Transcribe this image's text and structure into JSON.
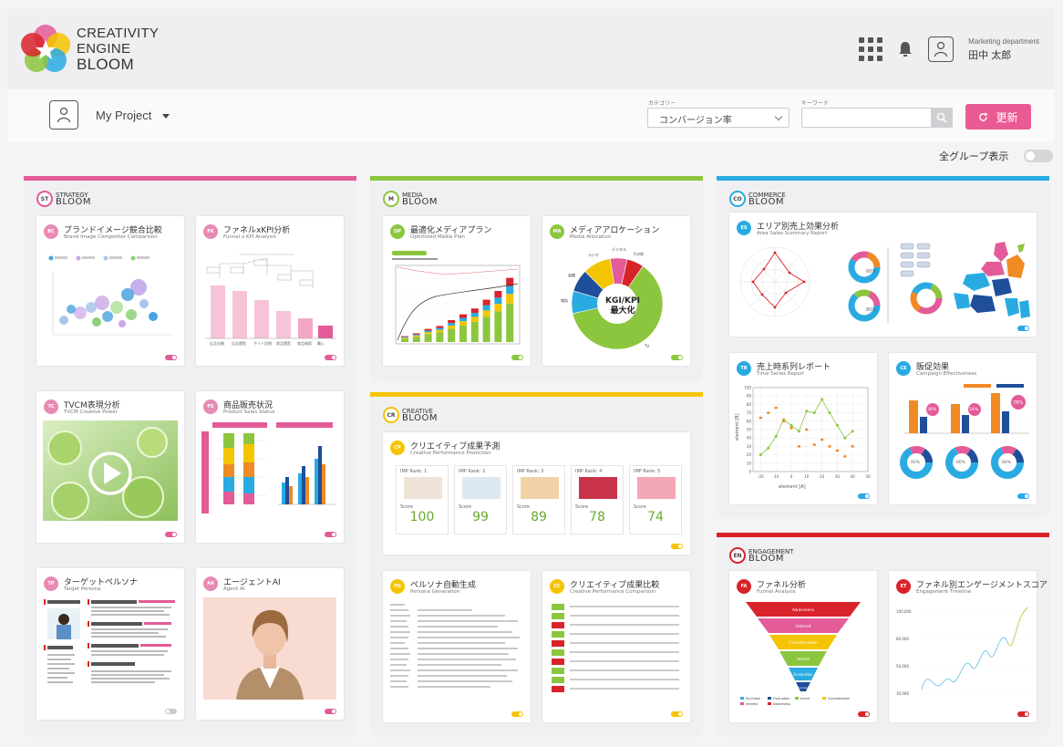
{
  "header": {
    "logo_line1": "CREATIVITY",
    "logo_line2": "ENGINE",
    "logo_line3": "BLOOM",
    "user_department": "Marketing department",
    "user_name": "田中 太郎",
    "icons": [
      "apps-grid-icon",
      "bell-icon",
      "user-icon"
    ]
  },
  "toolbar": {
    "project_label": "My Project",
    "category_label": "カテゴリー",
    "category_value": "コンバージョン率",
    "keyword_label": "キーワード",
    "keyword_value": "",
    "refresh_label": "更新"
  },
  "show_all_label": "全グループ表示",
  "colors": {
    "strategy": "#e35b98",
    "media": "#8cc63f",
    "commerce": "#29abe2",
    "creative": "#f5c400",
    "engagement": "#d9232a",
    "refresh": "#ea5b93"
  },
  "groups": {
    "strategy": {
      "line1": "STRATEGY",
      "line2": "BLOOM",
      "badge": "ST"
    },
    "media": {
      "line1": "MEDIA",
      "line2": "BLOOM",
      "badge": "M"
    },
    "commerce": {
      "line1": "COMMERCE",
      "line2": "BLOOM",
      "badge": "CO"
    },
    "creative": {
      "line1": "CREATIVE",
      "line2": "BLOOM",
      "badge": "CR"
    },
    "engagement": {
      "line1": "ENGAGEMENT",
      "line2": "BLOOM",
      "badge": "EN"
    }
  },
  "cards": {
    "bc": {
      "badge": "BC",
      "title": "ブランドイメージ競合比較",
      "subtitle": "Brand Image Competitor Comparison"
    },
    "fk": {
      "badge": "FK",
      "title": "ファネルxKPI分析",
      "subtitle": "Funnel x KPI Analysis"
    },
    "tc": {
      "badge": "TC",
      "title": "TVCM表現分析",
      "subtitle": "TVCM Creative Power"
    },
    "ps": {
      "badge": "PS",
      "title": "商品販売状況",
      "subtitle": "Product Sales Status"
    },
    "tp": {
      "badge": "TP",
      "title": "ターゲットペルソナ",
      "subtitle": "Target Persona"
    },
    "ai": {
      "badge": "AA",
      "title": "エージェントAI",
      "subtitle": "Agent AI"
    },
    "op": {
      "badge": "OP",
      "title": "最適化メディアプラン",
      "subtitle": "Optimized Media Plan"
    },
    "ma": {
      "badge": "MA",
      "title": "メディアアロケーション",
      "subtitle": "Media Allocation",
      "center_line1": "KGI/KPI",
      "center_line2": "最大化"
    },
    "cp": {
      "badge": "CP",
      "title": "クリエイティブ成果予測",
      "subtitle": "Creative Performance Prediction",
      "scores": [
        {
          "label": "IMP Rank: 1",
          "value": "100"
        },
        {
          "label": "IMP Rank: 2",
          "value": "99"
        },
        {
          "label": "IMP Rank: 3",
          "value": "89"
        },
        {
          "label": "IMP Rank: 4",
          "value": "78"
        },
        {
          "label": "IMP Rank: 5",
          "value": "74"
        }
      ],
      "score_caption": "Score"
    },
    "pg": {
      "badge": "PG",
      "title": "ペルソナ自動生成",
      "subtitle": "Persona Generation"
    },
    "cc": {
      "badge": "CC",
      "title": "クリエイティブ成果比較",
      "subtitle": "Creative Performance Comparison"
    },
    "es": {
      "badge": "ES",
      "title": "エリア別売上効果分析",
      "subtitle": "Area Sales Summary Report",
      "donut1": "60%",
      "donut2": "80%"
    },
    "tr": {
      "badge": "TR",
      "title": "売上時系列レポート",
      "subtitle": "Time Series Report",
      "xlabel": "element [A]",
      "ylabel": "element [B]"
    },
    "ce": {
      "badge": "CE",
      "title": "販促効果",
      "subtitle": "Campaign Effectiveness",
      "bubble1": "38%",
      "bubble2": "54%",
      "bubble3": "78%",
      "donut1": "80%",
      "donut2": "80%",
      "donut3": "80%"
    },
    "fa": {
      "badge": "FA",
      "title": "ファネル分析",
      "subtitle": "Funnel Analysis",
      "stages": [
        "Awareness",
        "Interest",
        "Consideration",
        "Intent",
        "Evaluation",
        "Purchase"
      ]
    },
    "et": {
      "badge": "ET",
      "title": "ファネル別エンゲージメントスコア",
      "subtitle": "Engagement Timeline",
      "yticks": [
        "100,000",
        "80,000",
        "50,000",
        "10,000"
      ]
    }
  },
  "chart_data": [
    {
      "type": "line",
      "title": "Time Series Report",
      "xlabel": "element [A]",
      "ylabel": "element [B]",
      "x": [
        -20,
        -10,
        0,
        10,
        20,
        30,
        40,
        50
      ],
      "xlim": [
        -25,
        50
      ],
      "ylim": [
        0,
        100
      ],
      "yticks": [
        0,
        10,
        20,
        30,
        40,
        50,
        60,
        70,
        80,
        90,
        100
      ],
      "series": [
        {
          "name": "",
          "color": "#8cc63f",
          "values": [
            [
              -20,
              20
            ],
            [
              -15,
              28
            ],
            [
              -10,
              42
            ],
            [
              -5,
              62
            ],
            [
              0,
              55
            ],
            [
              5,
              48
            ],
            [
              10,
              72
            ],
            [
              15,
              70
            ],
            [
              20,
              86
            ],
            [
              25,
              70
            ],
            [
              30,
              55
            ],
            [
              35,
              40
            ],
            [
              40,
              48
            ]
          ]
        },
        {
          "name": "",
          "color": "#f08a24",
          "values": [
            [
              -20,
              64
            ],
            [
              -15,
              70
            ],
            [
              -10,
              76
            ],
            [
              -5,
              60
            ],
            [
              0,
              52
            ],
            [
              5,
              30
            ],
            [
              10,
              50
            ],
            [
              15,
              32
            ],
            [
              20,
              38
            ],
            [
              25,
              30
            ],
            [
              30,
              25
            ],
            [
              35,
              18
            ],
            [
              40,
              30
            ]
          ]
        }
      ]
    },
    {
      "type": "bar",
      "title": "Optimized Media Plan",
      "categories": [
        "1",
        "2",
        "3",
        "4",
        "5",
        "6",
        "7",
        "8",
        "9",
        "10"
      ],
      "values": [
        8,
        12,
        18,
        22,
        30,
        38,
        46,
        58,
        70,
        88
      ],
      "ylim": [
        0,
        100
      ]
    },
    {
      "type": "pie",
      "title": "Media Allocation",
      "categories": [
        "TV",
        "雑誌",
        "新聞",
        "ラジオ",
        "デジタル",
        "その他"
      ],
      "values": [
        62,
        8,
        8,
        10,
        6,
        6
      ]
    }
  ]
}
